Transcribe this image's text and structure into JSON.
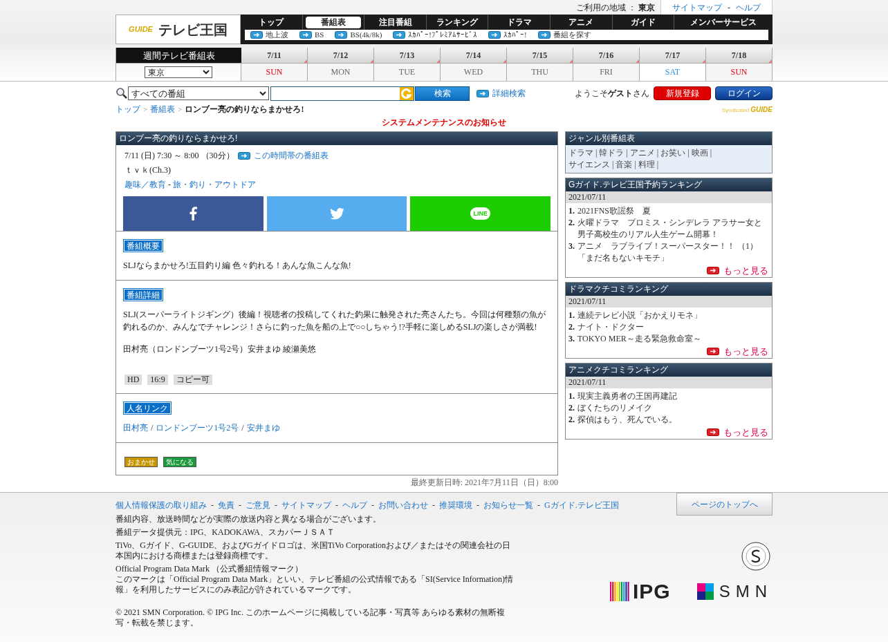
{
  "top_bar": {
    "region_label": "ご利用の地域 ：",
    "region": "東京",
    "links": [
      "サイトマップ",
      "ヘルプ"
    ],
    "separator": "-"
  },
  "logo": {
    "mark": "GUIDE",
    "name": "テレビ王国"
  },
  "nav": {
    "tabs": [
      {
        "label": "トップ",
        "selected": false
      },
      {
        "label": "番組表",
        "selected": true
      },
      {
        "label": "注目番組",
        "selected": false
      },
      {
        "label": "ランキング",
        "selected": false
      },
      {
        "label": "ドラマ",
        "selected": false
      },
      {
        "label": "アニメ",
        "selected": false
      },
      {
        "label": "ガイド",
        "selected": false
      },
      {
        "label": "メンバーサービス",
        "selected": false
      }
    ],
    "sub_links": [
      "地上波",
      "BS",
      "BS(4k/8k)",
      "ｽｶﾊﾟｰ!ﾌﾟﾚﾐｱﾑｻｰﾋﾞｽ",
      "ｽｶﾊﾟｰ!",
      "番組を探す"
    ]
  },
  "week": {
    "title": "週間テレビ番組表",
    "region_select": "東京",
    "days": [
      {
        "date": "7/11",
        "day": "SUN",
        "color": "#e60012"
      },
      {
        "date": "7/12",
        "day": "MON",
        "color": "#666666"
      },
      {
        "date": "7/13",
        "day": "TUE",
        "color": "#666666"
      },
      {
        "date": "7/14",
        "day": "WED",
        "color": "#666666"
      },
      {
        "date": "7/15",
        "day": "THU",
        "color": "#666666"
      },
      {
        "date": "7/16",
        "day": "FRI",
        "color": "#666666"
      },
      {
        "date": "7/17",
        "day": "SAT",
        "color": "#2a8ee0"
      },
      {
        "date": "7/18",
        "day": "SUN",
        "color": "#e60012"
      }
    ]
  },
  "search": {
    "category": "すべての番組",
    "button": "検索",
    "advanced": "詳細検索"
  },
  "user": {
    "greeting": "ようこそ**ゲスト**さん",
    "register": "新規登録",
    "login": "ログイン",
    "syndicated": "Syndicated",
    "mark": "GUIDE"
  },
  "breadcrumb": {
    "links": [
      "トップ",
      "番組表"
    ],
    "separator": ">",
    "current": "ロンブー亮の釣りならまかせろ!"
  },
  "notice": "システムメンテナンスのお知らせ",
  "program": {
    "title": "ロンブー亮の釣りならまかせろ!",
    "schedule": "7/11 (日) 7:30 ～ 8:00 （30分）",
    "schedule_link": "この時間帯の番組表",
    "channel": "ｔｖｋ(Ch.3)",
    "genres": [
      "趣味／教育",
      "旅・釣り・アウトドア"
    ],
    "genre_separator": "-",
    "share": [
      {
        "kind": "facebook"
      },
      {
        "kind": "twitter"
      },
      {
        "kind": "line",
        "label": "LINE"
      }
    ],
    "summary": {
      "label": "番組概要",
      "text": "SLJならまかせろ!五目釣り編 色々釣れる！あんな魚こんな魚!"
    },
    "detail": {
      "label": "番組詳細",
      "paragraphs": [
        "SLJ(スーパーライトジギング）後編！視聴者の投稿してくれた釣果に触発された亮さんたち。今回は何種類の魚が釣れるのか、みんなでチャレンジ！さらに釣った魚を船の上で○○しちゃう!?手軽に楽しめるSLJの楽しさが満載!",
        "田村亮（ロンドンブーツ1号2号）安井まゆ 綾瀬美悠"
      ],
      "tags": [
        "HD",
        "16:9",
        "コピー可"
      ]
    },
    "people": {
      "label": "人名リンク",
      "links": [
        "田村亮",
        "ロンドンブーツ1号2号",
        "安井まゆ"
      ],
      "separator": "/"
    },
    "actions": [
      {
        "label": "おまかせ",
        "color": "#c89600"
      },
      {
        "label": "気になる",
        "color": "#1a9a3c"
      }
    ],
    "updated": "最終更新日時: 2021年7月11日（日）8:00"
  },
  "sidebar": {
    "genre_box": {
      "title": "ジャンル別番組表",
      "lines": [
        [
          "ドラマ",
          "韓ドラ",
          "アニメ",
          "お笑い",
          "映画"
        ],
        [
          "サイエンス",
          "音楽",
          "料理"
        ]
      ],
      "separator": "|"
    },
    "rankings": [
      {
        "title": "Gガイド.テレビ王国予約ランキング",
        "date": "2021/07/11",
        "items": [
          {
            "rank": "1.",
            "title": "2021FNS歌謡祭　夏"
          },
          {
            "rank": "2.",
            "title": "火曜ドラマ　プロミス・シンデレラ アラサー女と男子高校生のリアル人生ゲーム開幕！"
          },
          {
            "rank": "3.",
            "title": "アニメ　ラブライブ！スーパースター！！ （1）「まだ名もないキモチ」"
          }
        ],
        "more": "もっと見る"
      },
      {
        "title": "ドラマクチコミランキング",
        "date": "2021/07/11",
        "items": [
          {
            "rank": "1.",
            "title": "連続テレビ小説「おかえりモネ」"
          },
          {
            "rank": "2.",
            "title": "ナイト・ドクター"
          },
          {
            "rank": "3.",
            "title": "TOKYO MER～走る緊急救命室～"
          }
        ],
        "more": "もっと見る"
      },
      {
        "title": "アニメクチコミランキング",
        "date": "2021/07/11",
        "items": [
          {
            "rank": "1.",
            "title": "現実主義勇者の王国再建記"
          },
          {
            "rank": "2.",
            "title": "ぼくたちのリメイク"
          },
          {
            "rank": "2.",
            "title": "探偵はもう、死んでいる。"
          }
        ],
        "more": "もっと見る"
      }
    ]
  },
  "footer": {
    "links": [
      "個人情報保護の取り組み",
      "免責",
      "ご意見",
      "サイトマップ",
      "ヘルプ",
      "お問い合わせ",
      "推奨環境",
      "お知らせ一覧",
      "Gガイド.テレビ王国"
    ],
    "separator": "-",
    "page_top": "ページのトップへ",
    "notes": [
      "番組内容、放送時間などが実際の放送内容と異なる場合がございます。",
      "番組データ提供元：IPG、KADOKAWA、スカパーＪＳＡＴ",
      "TiVo、Gガイド、G-GUIDE、およびGガイドロゴは、米国TiVo Corporationおよび／またはその関連会社の日本国内における商標または登録商標です。",
      "Official Program Data Mark （公式番組情報マーク）",
      "このマークは「Official Program Data Mark」といい、テレビ番組の公式情報である「SI(Service Information)情報」を利用したサービスにのみ表記が許されているマークです。"
    ],
    "copyright": "© 2021 SMN Corporation. © IPG Inc. このホームページに掲載している記事・写真等 あらゆる素材の無断複写・転載を禁じます。",
    "logos": [
      "IPG",
      "SMN"
    ]
  }
}
